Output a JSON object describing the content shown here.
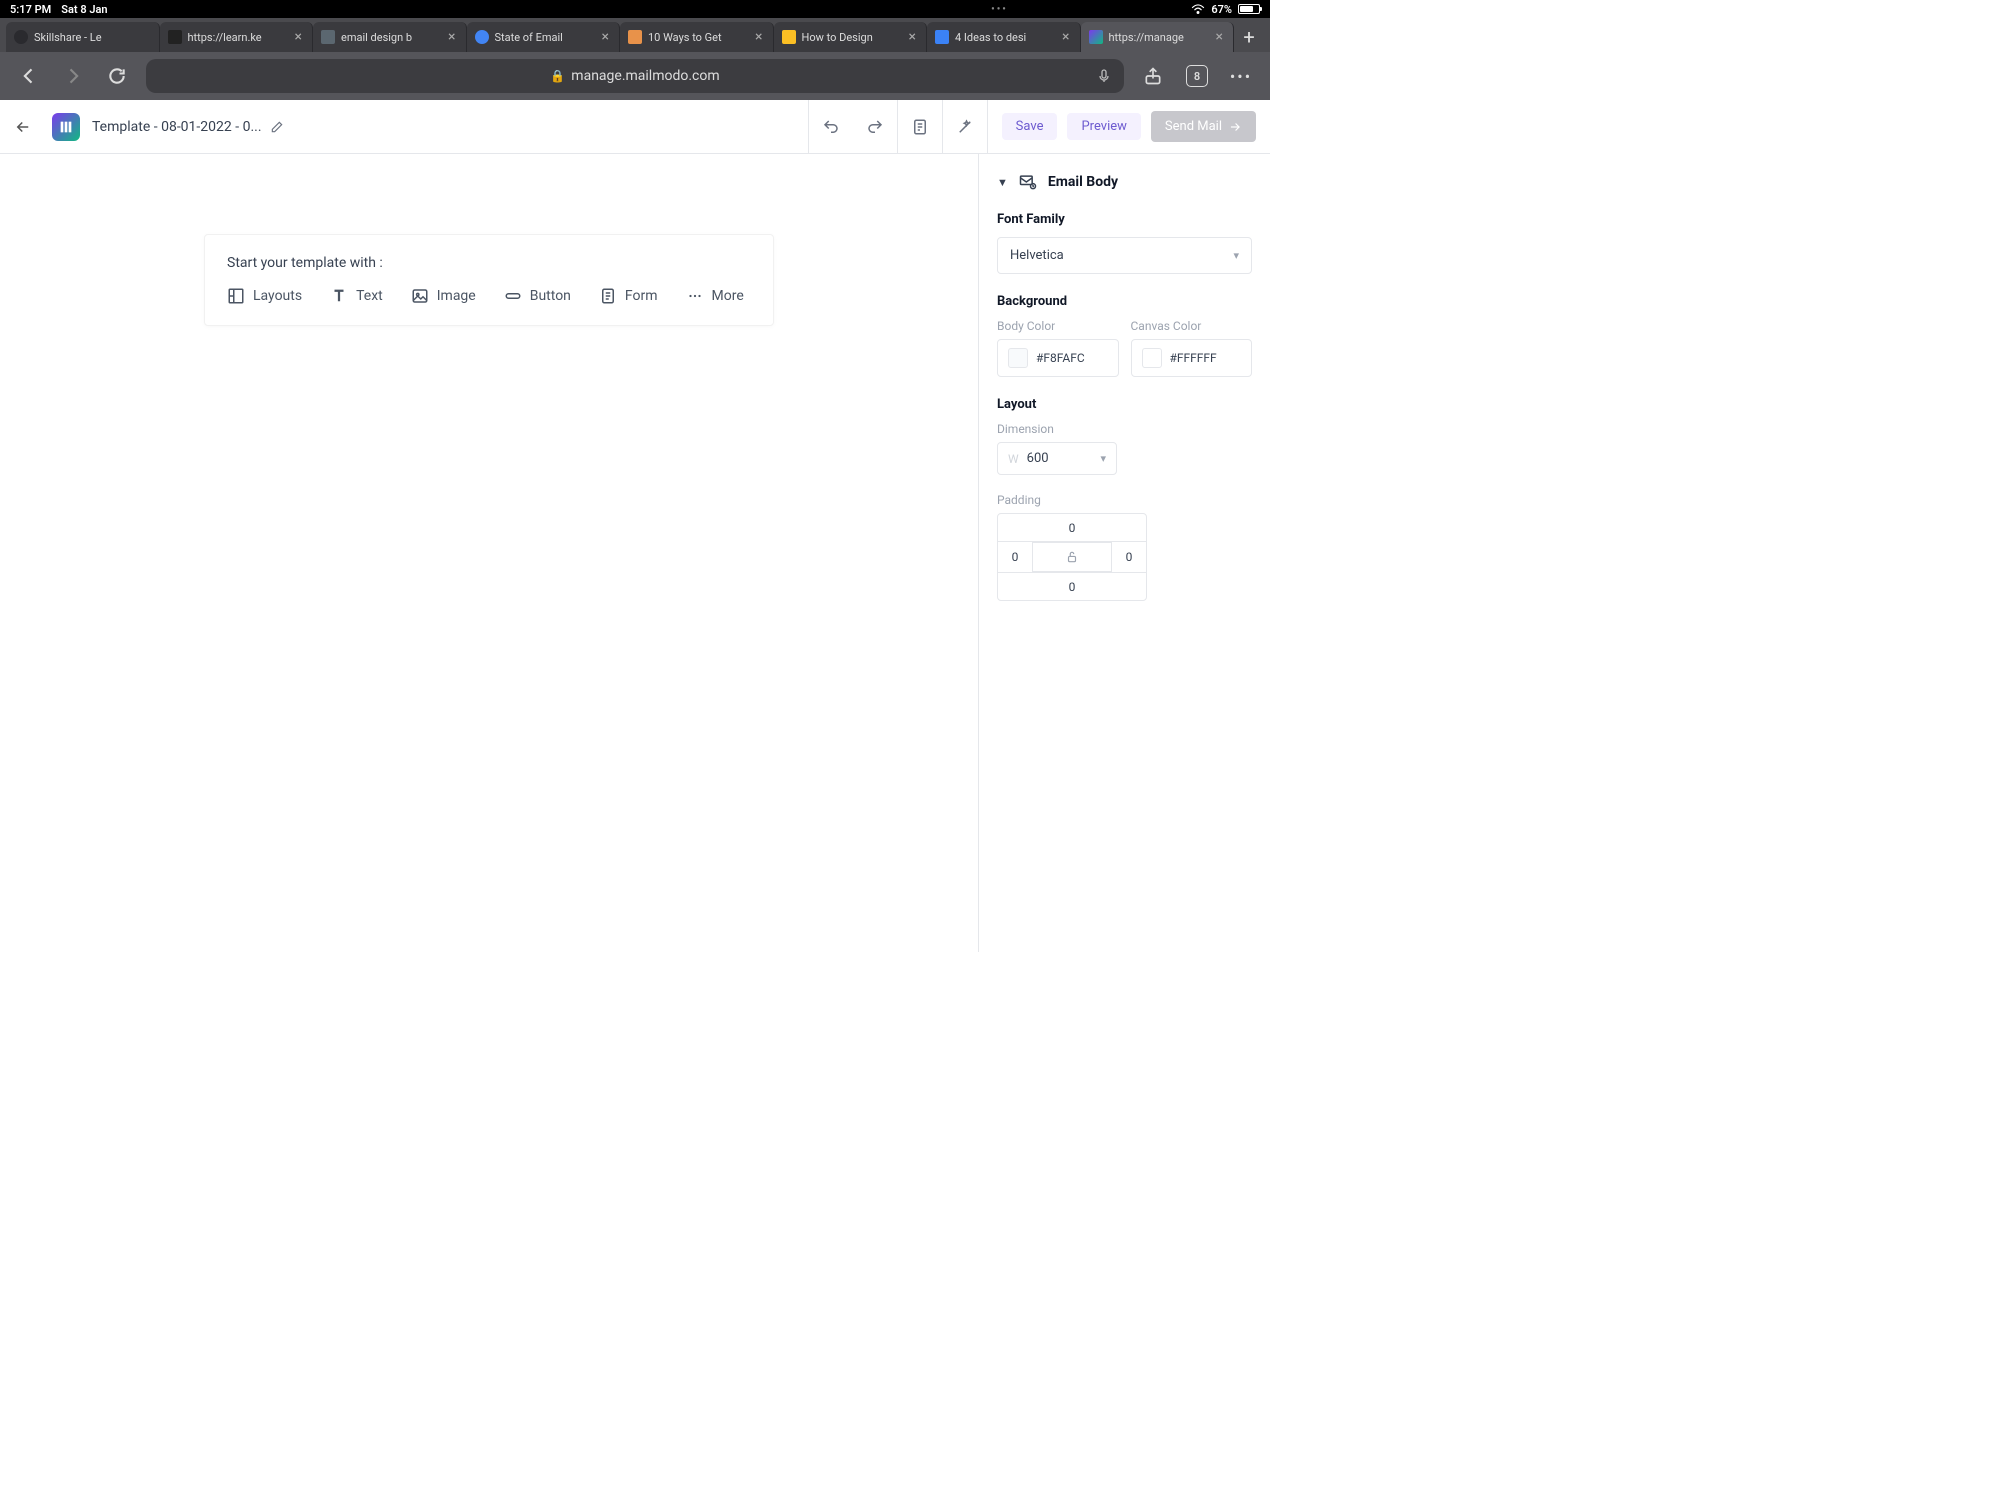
{
  "status": {
    "time": "5:17 PM",
    "date": "Sat 8 Jan",
    "battery": "67%"
  },
  "tabs": [
    {
      "title": "Skillshare - Le"
    },
    {
      "title": "https://learn.ke"
    },
    {
      "title": "email design b"
    },
    {
      "title": "State of Email"
    },
    {
      "title": "10 Ways to Get"
    },
    {
      "title": "How to Design"
    },
    {
      "title": "4 Ideas to desi"
    },
    {
      "title": "https://manage"
    }
  ],
  "url": "manage.mailmodo.com",
  "tab_count": "8",
  "header": {
    "template_name": "Template - 08-01-2022 - 0...",
    "save": "Save",
    "preview": "Preview",
    "send": "Send Mail"
  },
  "canvas": {
    "start_title": "Start your template with :",
    "options": {
      "layouts": "Layouts",
      "text": "Text",
      "image": "Image",
      "button": "Button",
      "form": "Form",
      "more": "More"
    }
  },
  "sidebar": {
    "panel_title": "Email Body",
    "font_family_label": "Font Family",
    "font_family_value": "Helvetica",
    "background_label": "Background",
    "body_color_label": "Body Color",
    "body_color_value": "#F8FAFC",
    "canvas_color_label": "Canvas Color",
    "canvas_color_value": "#FFFFFF",
    "layout_label": "Layout",
    "dimension_label": "Dimension",
    "dimension_prefix": "W",
    "dimension_value": "600",
    "padding_label": "Padding",
    "padding": {
      "top": "0",
      "right": "0",
      "bottom": "0",
      "left": "0"
    }
  }
}
